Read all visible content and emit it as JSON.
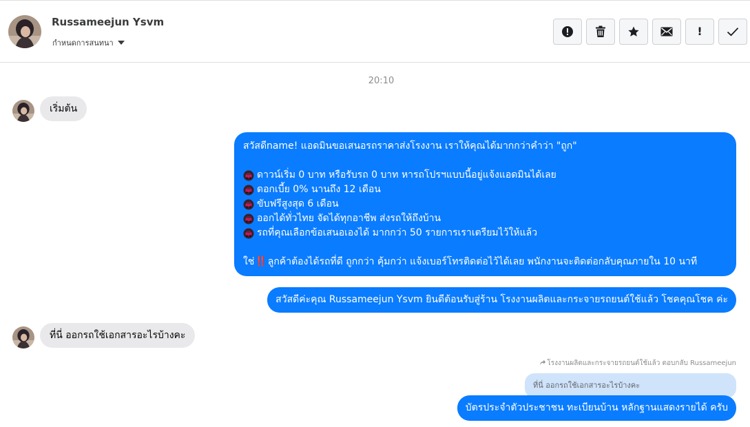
{
  "header": {
    "contact_name": "Russameejun Ysvm",
    "settings_label": "กำหนดการสนทนา",
    "toolbar": [
      "report-icon",
      "trash-icon",
      "star-icon",
      "mail-icon",
      "exclamation-icon",
      "check-icon"
    ]
  },
  "conversation": {
    "timestamp": "20:10",
    "msg_start": "เริ่มต้น",
    "offer": {
      "greeting": "สวัสดีname! แอดมินขอเสนอรถราคาส่งโรงงาน เราให้คุณได้มากกว่าคำว่า \"ถูก\"",
      "points": [
        "ดาวน์เริ่ม 0 บาท หรือรับรถ 0 บาท หารถโปรฯแบบนี้อยู่แจ้งแอดมินได้เลย",
        "ดอกเบี้ย 0% นานถึง 12 เดือน",
        "ขับฟรีสูงสุด 6 เดือน",
        "ออกได้ทั่วไทย จัดได้ทุกอาชีพ ส่งรถให้ถึงบ้าน",
        "รถที่คุณเลือกข้อเสนอเองได้ มากกว่า 50 รายการเราเตรียมไว้ให้แล้ว"
      ],
      "closing_prefix": "ใช่",
      "closing_emphasis": "‼️",
      "closing_rest": "ลูกค้าต้องได้รถที่ดี ถูกกว่า คุ้มกว่า แจ้งเบอร์โทรติดต่อไว้ได้เลย พนักงานจะติดต่อกลับคุณภายใน 10 นาที"
    },
    "welcome": "สวัสดีค่ะคุณ Russameejun Ysvm ยินดีต้อนรับสู่ร้าน โรงงานผลิตและกระจายรถยนต์ใช้แล้ว โชคคุณโชค ค่ะ",
    "question": "ที่นี่ ออกรถใช้เอกสารอะไรบ้างคะ",
    "reply_meta": "โรงงานผลิตและกระจายรถยนต์ใช้แล้ว ตอบกลับ Russameejun",
    "quoted": "ที่นี่ ออกรถใช้เอกสารอะไรบ้างคะ",
    "answer": "บัตรประจำตัวประชาชน ทะเบียนบ้าน หลักฐานแสดงรายได้ ครับ"
  },
  "colors": {
    "outgoing": "#0a7cff",
    "incoming": "#e9e9eb",
    "quoted": "#cfe3fb",
    "emphasis": "#ff3b30"
  }
}
